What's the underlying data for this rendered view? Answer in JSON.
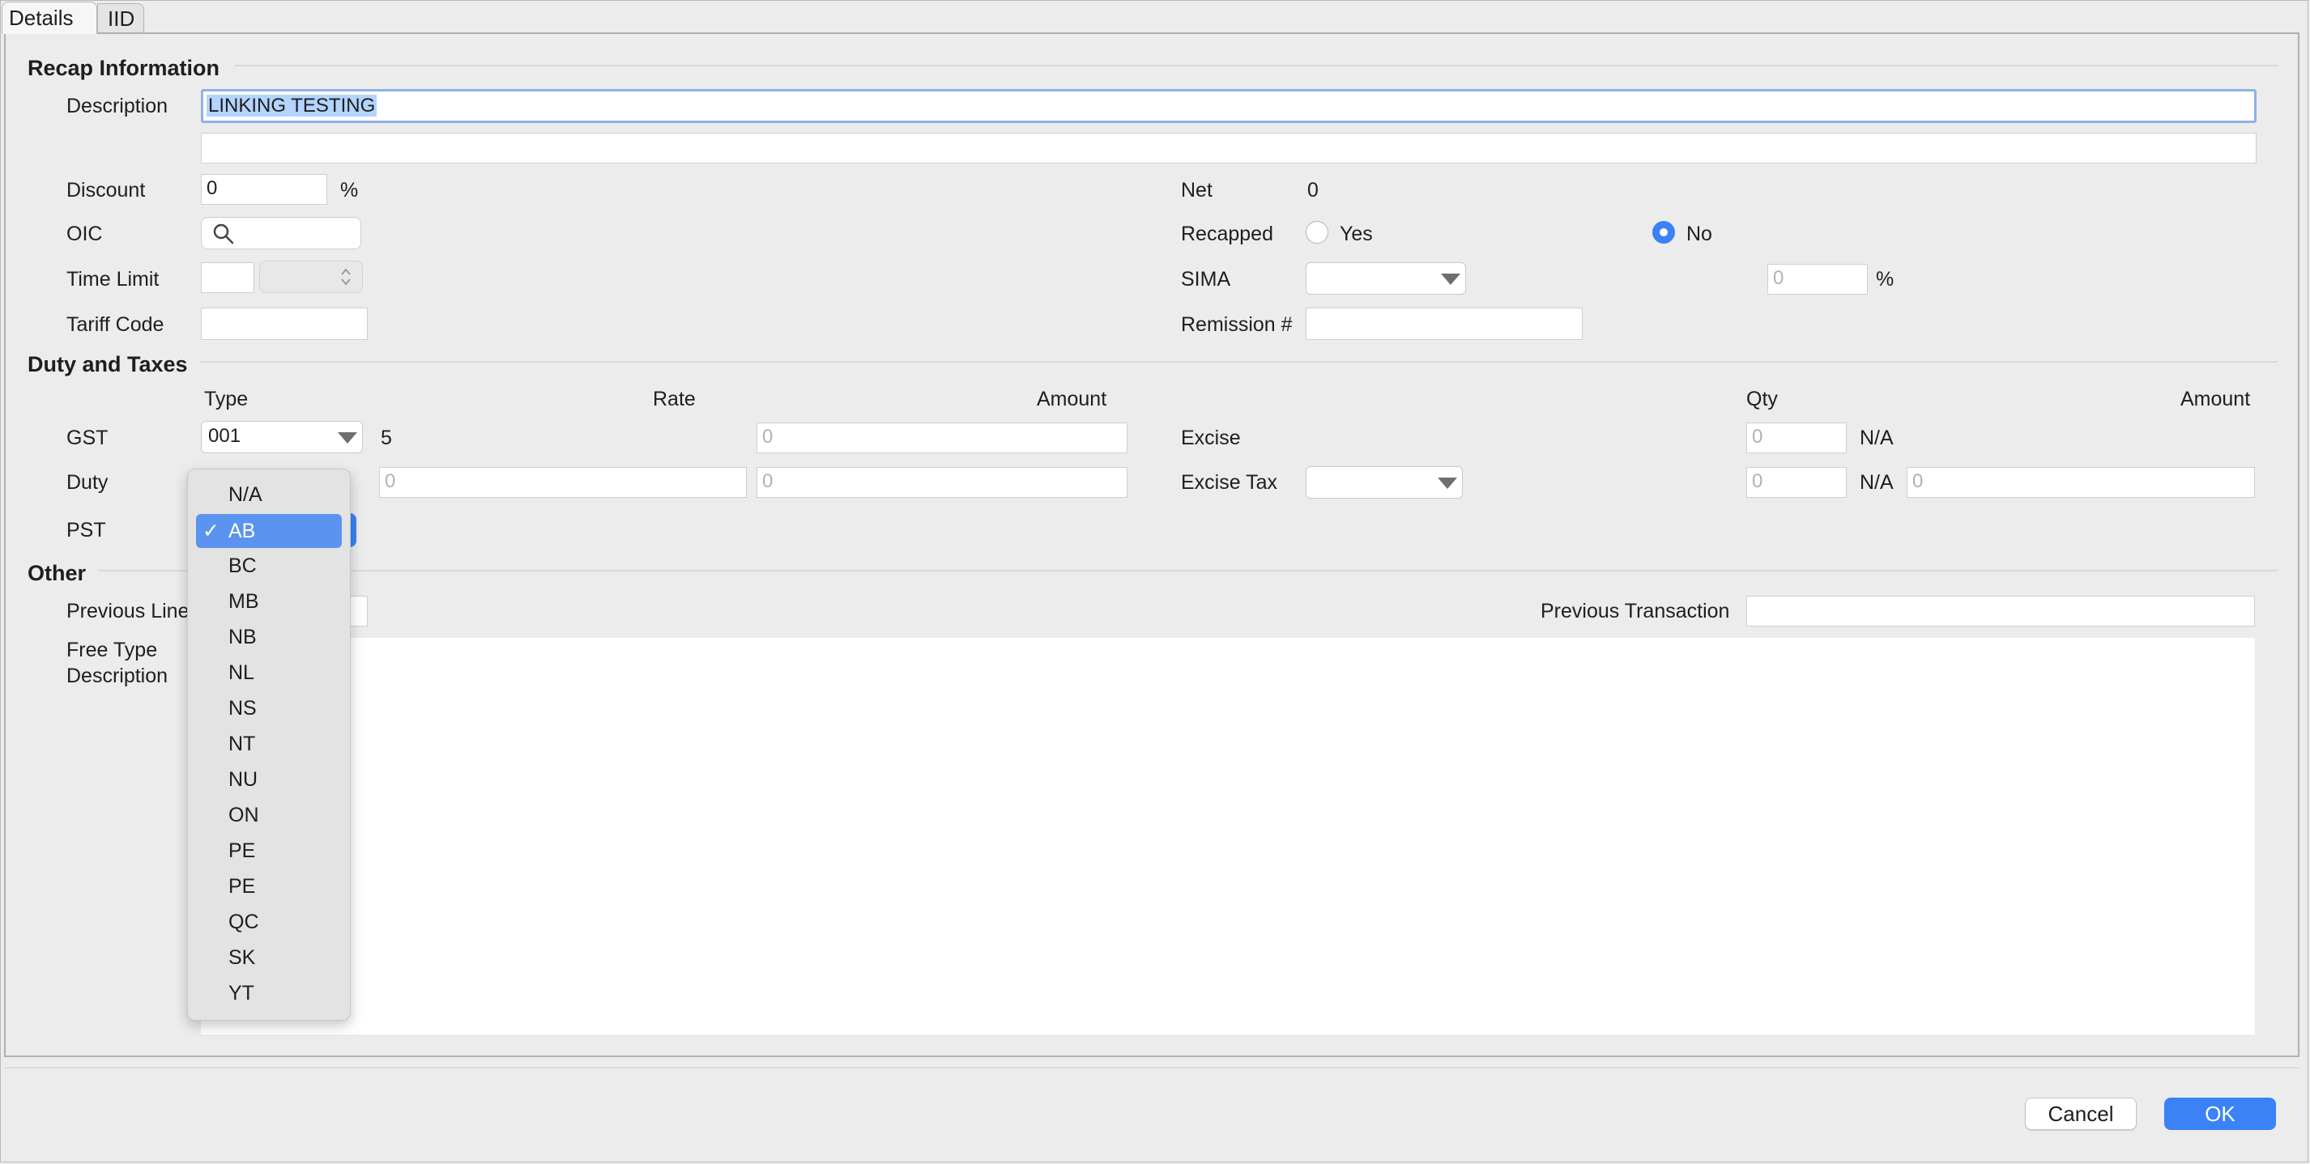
{
  "tabs": [
    {
      "label": "Details"
    },
    {
      "label": "IID"
    }
  ],
  "recap": {
    "heading": "Recap Information",
    "description_label": "Description",
    "description_value": "LINKING TESTING",
    "description_line2": "",
    "discount_label": "Discount",
    "discount_value": "0",
    "discount_unit": "%",
    "oic_label": "OIC",
    "time_limit_label": "Time Limit",
    "tariff_code_label": "Tariff Code",
    "net_label": "Net",
    "net_value": "0",
    "recapped_label": "Recapped",
    "recapped_yes": "Yes",
    "recapped_no": "No",
    "recapped_selected": "No",
    "sima_label": "SIMA",
    "sima_percent_value": "0",
    "sima_percent_unit": "%",
    "remission_label": "Remission #"
  },
  "duty": {
    "heading": "Duty and Taxes",
    "col_type": "Type",
    "col_rate": "Rate",
    "col_amount": "Amount",
    "col_qty": "Qty",
    "col_amount2": "Amount",
    "gst_label": "GST",
    "gst_type": "001",
    "gst_rate": "5",
    "gst_amount": "0",
    "duty_label": "Duty",
    "duty_rate": "0",
    "duty_amount": "0",
    "pst_label": "PST",
    "excise_label": "Excise",
    "excise_qty": "0",
    "excise_unit": "N/A",
    "excise_tax_label": "Excise Tax",
    "excise_tax_qty": "0",
    "excise_tax_unit": "N/A",
    "excise_tax_amount": "0"
  },
  "other": {
    "heading": "Other",
    "previous_line_label": "Previous Line",
    "previous_transaction_label": "Previous Transaction",
    "free_type_label_1": "Free Type",
    "free_type_label_2": "Description"
  },
  "pst_dropdown": {
    "selected": "AB",
    "check_glyph": "✓",
    "options": [
      "N/A",
      "AB",
      "BC",
      "MB",
      "NB",
      "NL",
      "NS",
      "NT",
      "NU",
      "ON",
      "PE",
      "PE",
      "QC",
      "SK",
      "YT"
    ]
  },
  "footer": {
    "cancel_label": "Cancel",
    "ok_label": "OK"
  },
  "colors": {
    "accent": "#3b82f6",
    "selection": "#b3d4fd",
    "menu_highlight": "#5a94f0"
  }
}
